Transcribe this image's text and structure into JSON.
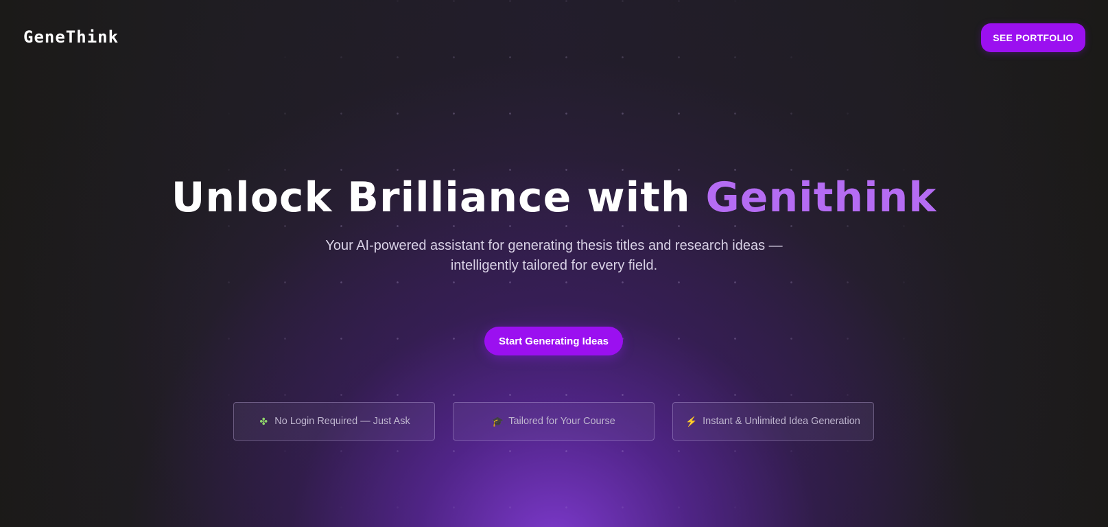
{
  "header": {
    "logo": "GeneThink",
    "portfolio_button": "SEE PORTFOLIO"
  },
  "hero": {
    "title_main": "Unlock Brilliance with ",
    "title_accent": "Genithink",
    "subtitle_line1": "Your AI-powered assistant for generating thesis titles and research ideas —",
    "subtitle_line2": "intelligently tailored for every field.",
    "cta_button": "Start Generating Ideas"
  },
  "features": [
    {
      "icon": "puzzle-icon",
      "glyph": "✤",
      "label": "No Login Required — Just Ask"
    },
    {
      "icon": "graduation-cap-icon",
      "glyph": "🎓",
      "label": "Tailored for Your Course"
    },
    {
      "icon": "lightning-icon",
      "glyph": "⚡",
      "label": "Instant & Unlimited Idea Generation"
    }
  ],
  "colors": {
    "accent": "#9b10f0",
    "accent_text": "#b56cf3",
    "background": "#1f1d22"
  }
}
